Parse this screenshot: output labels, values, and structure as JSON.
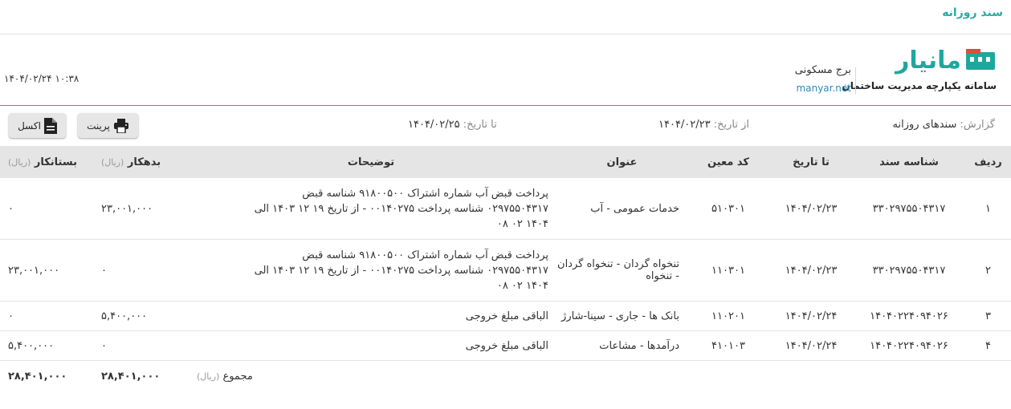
{
  "page": {
    "title": "سند روزانه"
  },
  "brand": {
    "name": "مانیار",
    "tagline": "سامانه یکپارچه مدیریت ساختمان",
    "org_name": "برج مسکونی",
    "website": "manyar.net",
    "datetime": "۱۴۰۴/۰۲/۲۴ ۱۰:۳۸",
    "logo_color": "#1fa79f"
  },
  "report": {
    "label": "گزارش:",
    "name": "سندهای روزانه",
    "from_label": "از تاریخ:",
    "from_date": "۱۴۰۴/۰۲/۲۳",
    "to_label": "تا تاریخ:",
    "to_date": "۱۴۰۴/۰۲/۲۵"
  },
  "toolbar": {
    "print_label": "پرینت",
    "print_icon": "printer-icon",
    "excel_label": "اکسل",
    "excel_icon": "document-icon"
  },
  "table": {
    "headers": {
      "row": "ردیف",
      "doc_id": "شناسه سند",
      "to_date": "تا تاریخ",
      "code": "کد معین",
      "title": "عنوان",
      "desc": "توضیحات",
      "debit": "بدهکار",
      "credit": "بستانکار",
      "unit": "(ریال)"
    },
    "rows": [
      {
        "row": "۱",
        "doc_id": "۳۳۰۲۹۷۵۵۰۴۳۱۷",
        "date": "۱۴۰۴/۰۲/۲۳",
        "code": "۵۱۰۳۰۱",
        "title": "خدمات عمومی - آب",
        "desc_lines": [
          "پرداخت قبض آب شماره اشتراک ۹۱۸۰۰۵۰۰ شناسه قبض",
          "۰۲۹۷۵۵۰۴۳۱۷ شناسه پرداخت ۰۰۱۴۰۲۷۵ - از تاریخ ۱۹ ۱۲ ۱۴۰۳ الی",
          "۱۴۰۴ ۰۲ ۰۸"
        ],
        "debit": "۲۳,۰۰۱,۰۰۰",
        "credit": "۰"
      },
      {
        "row": "۲",
        "doc_id": "۳۳۰۲۹۷۵۵۰۴۳۱۷",
        "date": "۱۴۰۴/۰۲/۲۳",
        "code": "۱۱۰۳۰۱",
        "title": "تنخواه گردان - تنخواه گردان - تنخواه",
        "desc_lines": [
          "پرداخت قبض آب شماره اشتراک ۹۱۸۰۰۵۰۰ شناسه قبض",
          "۰۲۹۷۵۵۰۴۳۱۷ شناسه پرداخت ۰۰۱۴۰۲۷۵ - از تاریخ ۱۹ ۱۲ ۱۴۰۳ الی",
          "۱۴۰۴ ۰۲ ۰۸"
        ],
        "debit": "۰",
        "credit": "۲۳,۰۰۱,۰۰۰"
      },
      {
        "row": "۳",
        "doc_id": "۱۴۰۴۰۲۲۴۰۹۴۰۲۶",
        "date": "۱۴۰۴/۰۲/۲۴",
        "code": "۱۱۰۲۰۱",
        "title": "بانک ها - جاری - سینا-شارژ",
        "desc_lines": [
          "الباقی مبلغ خروجی"
        ],
        "debit": "۵,۴۰۰,۰۰۰",
        "credit": "۰"
      },
      {
        "row": "۴",
        "doc_id": "۱۴۰۴۰۲۲۴۰۹۴۰۲۶",
        "date": "۱۴۰۴/۰۲/۲۴",
        "code": "۴۱۰۱۰۳",
        "title": "درآمدها - مشاعات",
        "desc_lines": [
          "الباقی مبلغ خروجی"
        ],
        "debit": "۰",
        "credit": "۵,۴۰۰,۰۰۰"
      }
    ],
    "total": {
      "label": "مجموع",
      "unit": "(ریال)",
      "debit": "۲۸,۴۰۱,۰۰۰",
      "credit": "۲۸,۴۰۱,۰۰۰"
    }
  }
}
